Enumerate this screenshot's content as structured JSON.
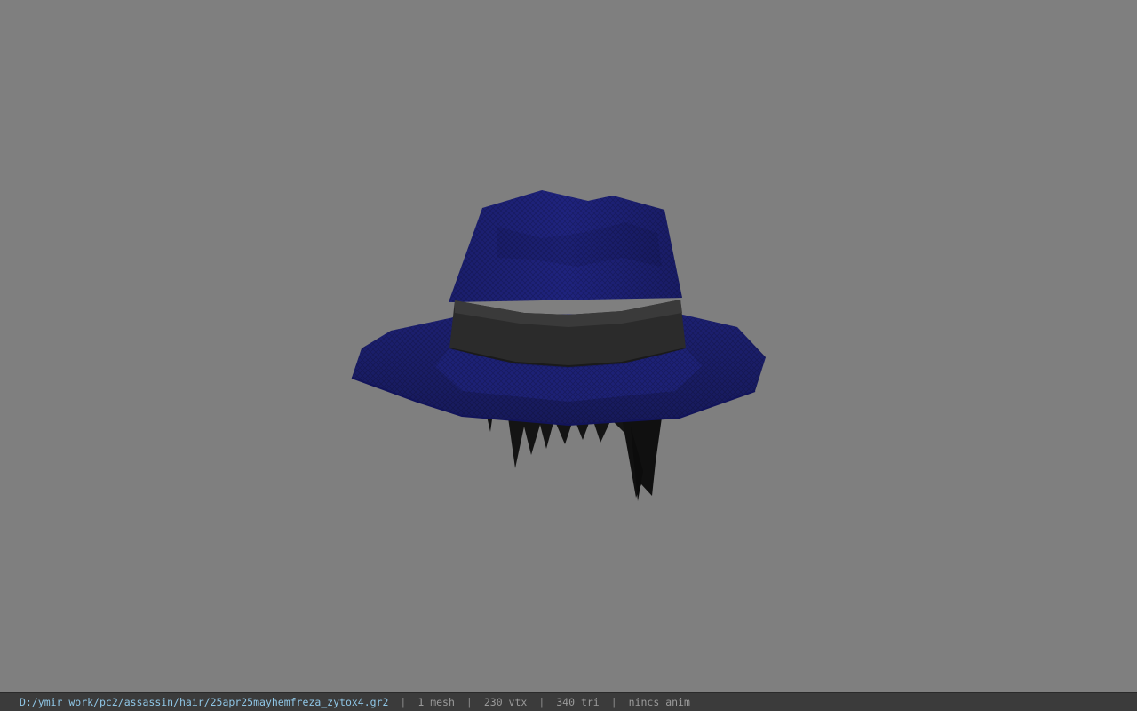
{
  "viewer": {
    "background_color": "#7f7f7f",
    "model_name": "fedora-hat-with-hair",
    "colors": {
      "hat_crown": "#1f237e",
      "hat_brim": "#1e2278",
      "hat_band": "#2b2b2b",
      "hair": "#111111"
    }
  },
  "status_bar": {
    "file_path": "D:/ymir work/pc2/assassin/hair/25apr25mayhemfreza_zytox4.gr2",
    "separator": "|",
    "mesh_count": "1 mesh",
    "vertex_count": "230 vtx",
    "triangle_count": "340 tri",
    "anim_status": "nincs anim"
  }
}
